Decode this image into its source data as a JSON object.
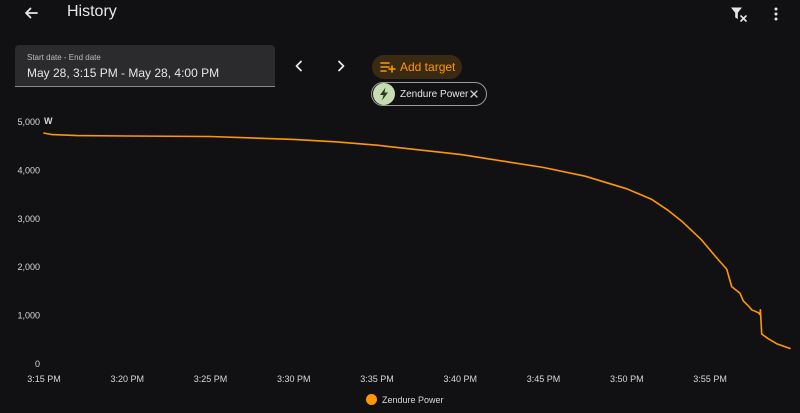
{
  "header": {
    "title": "History"
  },
  "date_picker": {
    "label": "Start date - End date",
    "value": "May 28, 3:15 PM - May 28, 4:00 PM"
  },
  "add_target": {
    "label": "Add target"
  },
  "targets": [
    {
      "label": "Zendure Power",
      "icon": "lightning-bolt-icon"
    }
  ],
  "colors": {
    "accent": "#ff9800",
    "background": "#111113",
    "chip_avatar": "#c8dcb4"
  },
  "chart_data": {
    "type": "line",
    "ylabel": "W",
    "ylim": [
      0,
      5000
    ],
    "yticks": [
      0,
      1000,
      2000,
      3000,
      4000,
      5000
    ],
    "ytick_labels": [
      "0",
      "1,000",
      "2,000",
      "3,000",
      "4,000",
      "5,000"
    ],
    "xticks": [
      "3:15 PM",
      "3:20 PM",
      "3:25 PM",
      "3:30 PM",
      "3:35 PM",
      "3:40 PM",
      "3:45 PM",
      "3:50 PM",
      "3:55 PM"
    ],
    "xlim_minutes": [
      0,
      45
    ],
    "grid": false,
    "legend_position": "bottom",
    "series": [
      {
        "name": "Zendure Power",
        "color": "#ff9800",
        "x_minutes": [
          0,
          0.5,
          2,
          5,
          10,
          15,
          17.5,
          20,
          25,
          30,
          32.5,
          35,
          36.5,
          37.5,
          38.3,
          39.5,
          40.5,
          41.0,
          41.3,
          41.8,
          42.0,
          42.3,
          42.5,
          42.9,
          43.0,
          43.02,
          43.1,
          43.5,
          44,
          44.8
        ],
        "values": [
          4770,
          4740,
          4720,
          4710,
          4700,
          4640,
          4590,
          4520,
          4330,
          4060,
          3880,
          3620,
          3400,
          3170,
          2950,
          2560,
          2150,
          1960,
          1600,
          1460,
          1300,
          1200,
          1120,
          1060,
          1020,
          1120,
          620,
          520,
          420,
          320
        ]
      }
    ]
  }
}
